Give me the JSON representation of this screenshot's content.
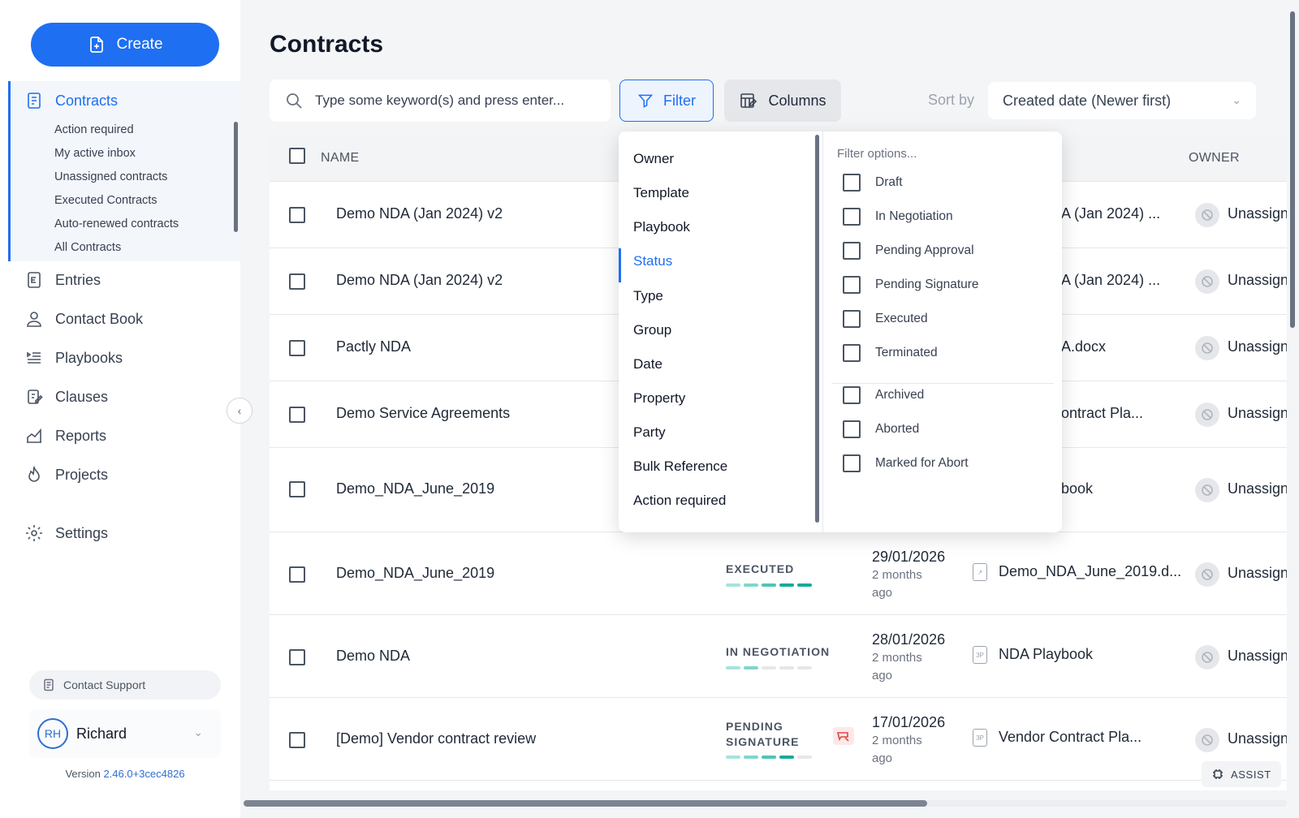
{
  "sidebar": {
    "create_label": "Create",
    "nav": {
      "contracts": "Contracts",
      "entries": "Entries",
      "contact_book": "Contact Book",
      "playbooks": "Playbooks",
      "clauses": "Clauses",
      "reports": "Reports",
      "projects": "Projects",
      "settings": "Settings"
    },
    "contract_views": [
      "Action required",
      "My active inbox",
      "Unassigned contracts",
      "Executed Contracts",
      "Auto-renewed contracts",
      "All Contracts"
    ],
    "support_label": "Contact Support",
    "user": {
      "initials": "RH",
      "name": "Richard"
    },
    "version_label": "Version",
    "version_number": "2.46.0+3cec4826"
  },
  "page": {
    "title": "Contracts",
    "search_placeholder": "Type some keyword(s) and press enter...",
    "filter_label": "Filter",
    "columns_label": "Columns",
    "sort_by_label": "Sort by",
    "sort_value": "Created date (Newer first)"
  },
  "table": {
    "headers": {
      "name": "NAME",
      "owner": "OWNER"
    },
    "rows": [
      {
        "name": "Demo NDA (Jan 2024) v2",
        "playbook": "A (Jan 2024) ...",
        "owner": "Unassign"
      },
      {
        "name": "Demo NDA (Jan 2024) v2",
        "playbook": "A (Jan 2024) ...",
        "owner": "Unassign"
      },
      {
        "name": "Pactly NDA",
        "playbook": "A.docx",
        "owner": "Unassign"
      },
      {
        "name": "Demo Service Agreements",
        "playbook": "ontract Pla...",
        "owner": "Unassign"
      },
      {
        "name": "Demo_NDA_June_2019",
        "playbook": "book",
        "owner": "Unassign"
      },
      {
        "name": "Demo_NDA_June_2019",
        "status": "EXECUTED",
        "progress_steps": 5,
        "progress_total": 5,
        "date": "29/01/2026",
        "ago": "2 months ago",
        "playbook_badge": "↗",
        "playbook": "Demo_NDA_June_2019.d...",
        "owner": "Unassign"
      },
      {
        "name": "Demo NDA",
        "status": "IN NEGOTIATION",
        "progress_steps": 2,
        "progress_total": 5,
        "date": "28/01/2026",
        "ago": "2 months ago",
        "playbook_badge": "3P",
        "playbook": "NDA Playbook",
        "owner": "Unassign"
      },
      {
        "name": "[Demo] Vendor contract review",
        "status": "PENDING SIGNATURE",
        "progress_steps": 4,
        "progress_total": 5,
        "date": "17/01/2026",
        "ago": "2 months ago",
        "playbook_badge": "3P",
        "playbook": "Vendor Contract Pla...",
        "owner": "Unassign"
      }
    ],
    "assist_label": "ASSIST"
  },
  "filter_dropdown": {
    "categories": [
      "Owner",
      "Template",
      "Playbook",
      "Status",
      "Type",
      "Group",
      "Date",
      "Property",
      "Party",
      "Bulk Reference",
      "Action required"
    ],
    "active_category": "Status",
    "options_placeholder": "Filter options...",
    "options": [
      "Draft",
      "In Negotiation",
      "Pending Approval",
      "Pending Signature",
      "Executed",
      "Terminated"
    ],
    "options_secondary": [
      "Archived",
      "Aborted",
      "Marked for Abort"
    ]
  },
  "colors": {
    "accent": "#1e6ff1",
    "progress": "#1aa999",
    "alert": "#e24545"
  }
}
